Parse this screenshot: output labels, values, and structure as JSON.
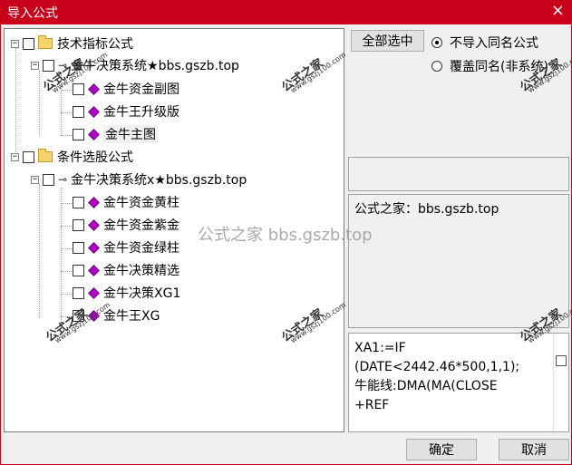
{
  "window": {
    "title": "导入公式",
    "close_glyph": "×"
  },
  "tree": {
    "groups": [
      {
        "label": "技术指标公式",
        "expander": "−",
        "children": [
          {
            "label": "金牛决策系统★bbs.gszb.top",
            "expander": "−",
            "children": [
              {
                "label": "金牛资金副图"
              },
              {
                "label": "金牛王升级版"
              },
              {
                "label": "金牛主图"
              }
            ]
          }
        ]
      },
      {
        "label": "条件选股公式",
        "expander": "−",
        "children": [
          {
            "label": "金牛决策系统x★bbs.gszb.top",
            "expander": "−",
            "children": [
              {
                "label": "金牛资金黄柱"
              },
              {
                "label": "金牛资金紫金"
              },
              {
                "label": "金牛资金绿柱"
              },
              {
                "label": "金牛决策精选"
              },
              {
                "label": "金牛决策XG1"
              },
              {
                "label": "金牛王XG"
              }
            ]
          }
        ]
      }
    ]
  },
  "controls": {
    "select_all": "全部选中",
    "radio_options": [
      {
        "label": "不导入同名公式",
        "selected": true
      },
      {
        "label": "覆盖同名(非系统)",
        "selected": false
      }
    ]
  },
  "info": {
    "text": "公式之家：bbs.gszb.top"
  },
  "formula": {
    "lines": [
      "XA1:=IF",
      "(DATE<2442.46*500,1,1);",
      "牛能线:DMA(MA(CLOSE",
      "+REF"
    ]
  },
  "watermarks": {
    "brand": "公式之家",
    "url": "www.gszj100.com",
    "center": "公式之家 bbs.gszb.top"
  },
  "footer": {
    "ok": "确定",
    "cancel": "取消"
  }
}
